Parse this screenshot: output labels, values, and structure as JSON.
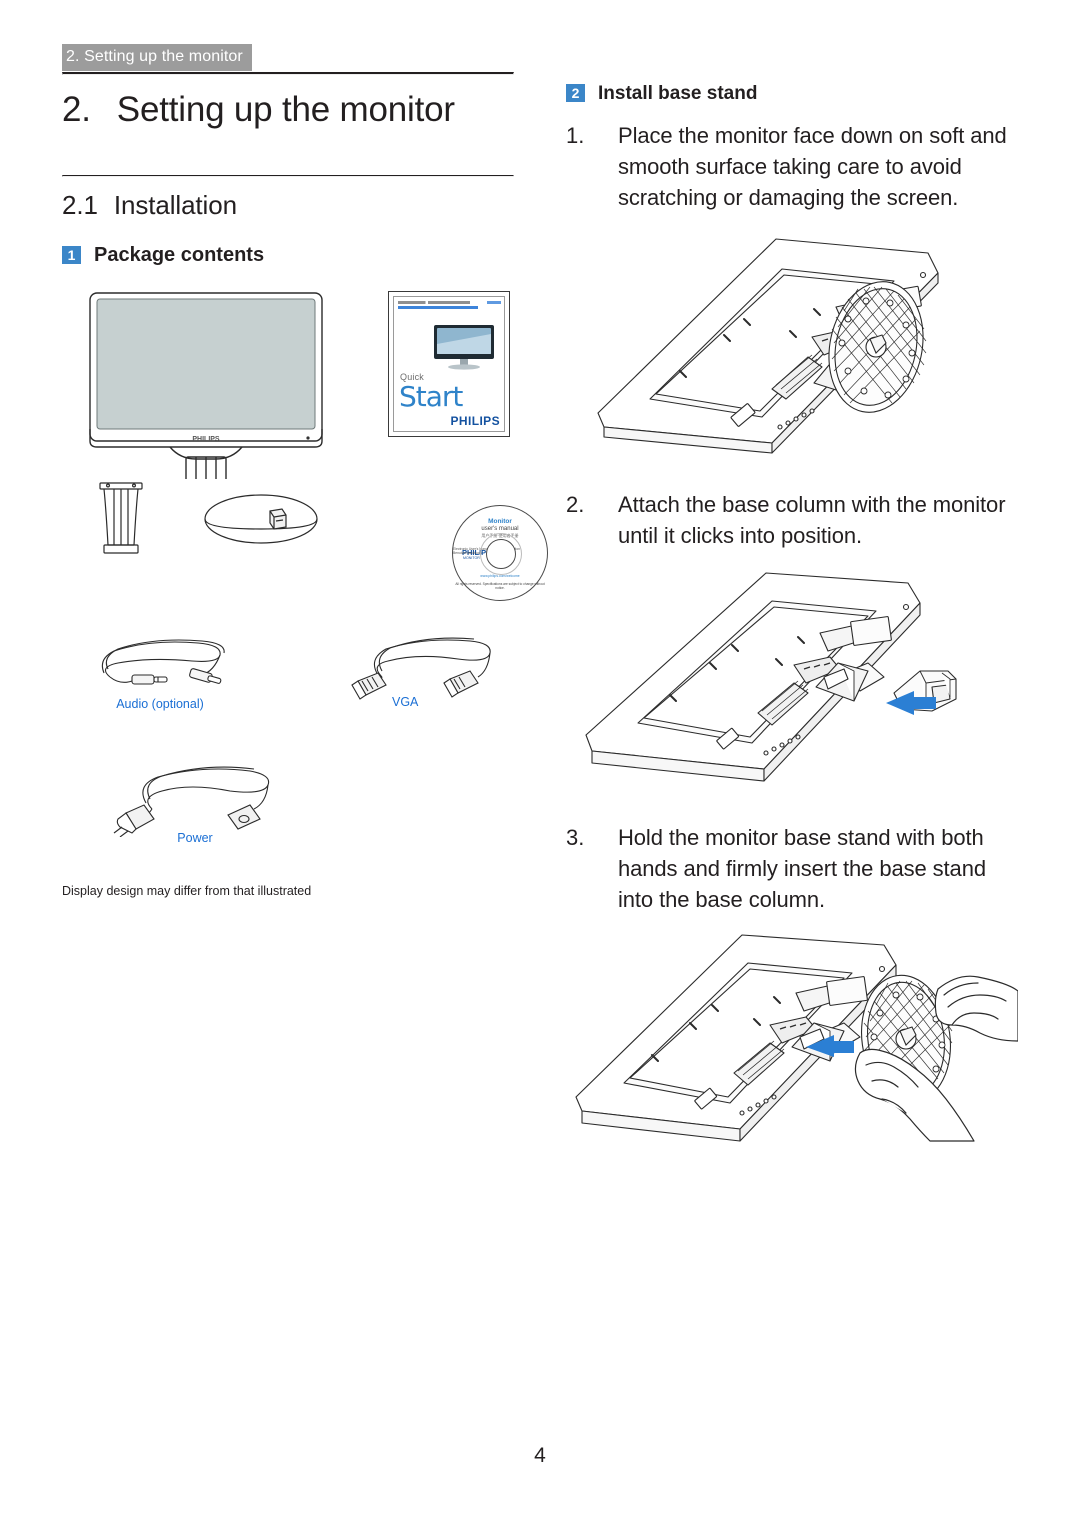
{
  "document": {
    "running_header": "2. Setting up the monitor",
    "page_number": "4"
  },
  "left_column": {
    "chapter_number": "2.",
    "chapter_title": "Setting up the monitor",
    "section_number": "2.1",
    "section_title": "Installation",
    "subsection": {
      "badge": "1",
      "label": "Package contents"
    },
    "package_items": [
      {
        "name": "monitor",
        "label": ""
      },
      {
        "name": "quick-start-guide",
        "label": ""
      },
      {
        "name": "base-column",
        "label": ""
      },
      {
        "name": "base-stand",
        "label": ""
      },
      {
        "name": "cd-user-manual",
        "label": ""
      },
      {
        "name": "audio-cable",
        "label": "Audio (optional)"
      },
      {
        "name": "vga-cable",
        "label": "VGA"
      },
      {
        "name": "power-cable",
        "label": "Power"
      }
    ],
    "booklet": {
      "quick": "Quick",
      "start": "Start",
      "brand": "PHILIPS"
    },
    "cd": {
      "title": "Monitor",
      "subtitle": "user's manual",
      "subtitle2": "用户手册·使用者手册",
      "brand": "PHILIPS",
      "brand_sub": "MONITOR",
      "side_text": "Electronic\nUser's Manual\nManuel d'utilisation\nBenutzerhandbuch",
      "blue_text": "www.philips.com/welcome",
      "bottom_text": "All rights reserved.\nSpecifications are subject to change without notice."
    },
    "footnote": "Display design may differ from that illustrated"
  },
  "right_column": {
    "subsection": {
      "badge": "2",
      "label": "Install base stand"
    },
    "steps": [
      {
        "number": "1.",
        "text": "Place the monitor face down on soft and smooth surface taking care to avoid scratching or damaging the screen."
      },
      {
        "number": "2.",
        "text": "Attach the base column with the monitor until it clicks into position."
      },
      {
        "number": "3.",
        "text": "Hold the monitor base stand with both hands and firmly insert the base stand into the base column."
      }
    ],
    "figures": [
      {
        "name": "monitor-face-down-with-base-stand",
        "arrow": "none"
      },
      {
        "name": "attach-base-column-to-monitor",
        "arrow": "left"
      },
      {
        "name": "insert-base-stand-into-column-with-hands",
        "arrow": "left"
      }
    ]
  },
  "colors": {
    "header_band": "#9c9c9c",
    "badge_blue": "#3b86c8",
    "label_blue": "#1b6fd4",
    "arrow_blue": "#2b7fd4",
    "text": "#231f20",
    "screen_fill": "#c6d0d0"
  }
}
